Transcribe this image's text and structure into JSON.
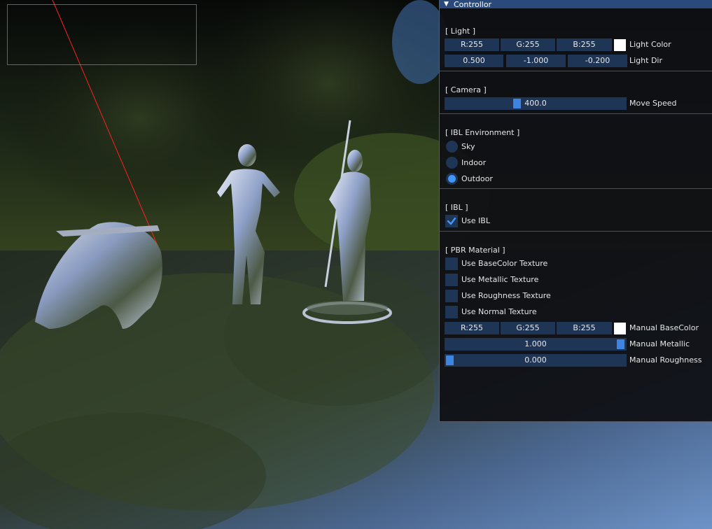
{
  "panel": {
    "title": "Controllor",
    "collapse_icon": "triangle-down-icon",
    "light": {
      "header": "[ Light ]",
      "color": {
        "r": "R:255",
        "g": "G:255",
        "b": "B:255",
        "label": "Light Color",
        "swatch": "#ffffff"
      },
      "dir": {
        "x": "0.500",
        "y": "-1.000",
        "z": "-0.200",
        "label": "Light Dir"
      }
    },
    "camera": {
      "header": "[ Camera ]",
      "move_speed": {
        "value": "400.0",
        "label": "Move Speed",
        "fraction": 0.4
      }
    },
    "ibl_env": {
      "header": "[ IBL Environment ]",
      "options": [
        {
          "label": "Sky",
          "selected": false
        },
        {
          "label": "Indoor",
          "selected": false
        },
        {
          "label": "Outdoor",
          "selected": true
        }
      ]
    },
    "ibl": {
      "header": "[ IBL ]",
      "use_ibl": {
        "label": "Use IBL",
        "checked": true
      }
    },
    "pbr": {
      "header": "[ PBR Material ]",
      "textures": [
        {
          "label": "Use BaseColor Texture",
          "checked": false
        },
        {
          "label": "Use Metallic Texture",
          "checked": false
        },
        {
          "label": "Use Roughness Texture",
          "checked": false
        },
        {
          "label": "Use Normal Texture",
          "checked": false
        }
      ],
      "base_color": {
        "r": "R:255",
        "g": "G:255",
        "b": "B:255",
        "label": "Manual BaseColor",
        "swatch": "#ffffff"
      },
      "metallic": {
        "value": "1.000",
        "label": "Manual Metallic",
        "fraction": 1.0
      },
      "roughness": {
        "value": "0.000",
        "label": "Manual Roughness",
        "fraction": 0.0
      }
    }
  },
  "colors": {
    "title_bar": "#294a7a",
    "frame_bg": "#1f3556",
    "slider_grab": "#3d85e0",
    "checkmark": "#4296fa"
  }
}
